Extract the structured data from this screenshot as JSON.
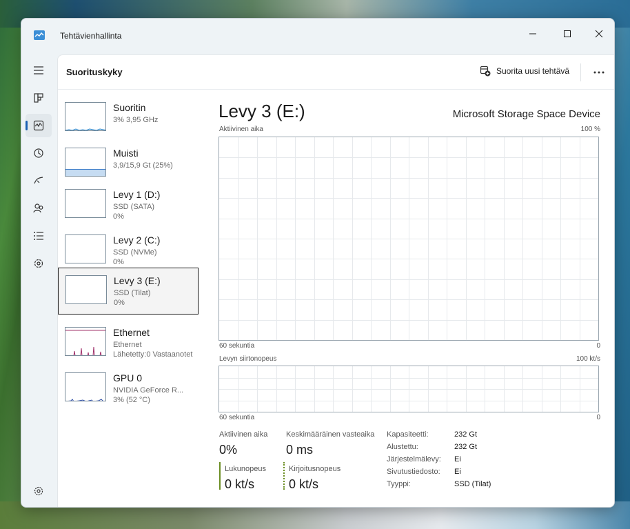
{
  "window": {
    "title": "Tehtävienhallinta"
  },
  "header": {
    "page_title": "Suorituskyky",
    "run_task_label": "Suorita uusi tehtävä"
  },
  "devices": [
    {
      "name": "Suoritin",
      "sub1": "3% 3,95 GHz",
      "sub2": ""
    },
    {
      "name": "Muisti",
      "sub1": "3,9/15,9 Gt (25%)",
      "sub2": ""
    },
    {
      "name": "Levy 1 (D:)",
      "sub1": "SSD (SATA)",
      "sub2": "0%"
    },
    {
      "name": "Levy 2 (C:)",
      "sub1": "SSD (NVMe)",
      "sub2": "0%"
    },
    {
      "name": "Levy 3 (E:)",
      "sub1": "SSD (Tilat)",
      "sub2": "0%"
    },
    {
      "name": "Ethernet",
      "sub1": "Ethernet",
      "sub2": "Lähetetty:0 Vastaanotet"
    },
    {
      "name": "GPU 0",
      "sub1": "NVIDIA GeForce R...",
      "sub2": "3% (52 °C)"
    }
  ],
  "main": {
    "title": "Levy 3 (E:)",
    "model": "Microsoft Storage Space Device",
    "graph1": {
      "label": "Aktiivinen aika",
      "max": "100 %",
      "time": "60 sekuntia",
      "min": "0"
    },
    "graph2": {
      "label": "Levyn siirtonopeus",
      "max": "100 kt/s",
      "time": "60 sekuntia",
      "min": "0"
    },
    "stats": {
      "active_label": "Aktiivinen aika",
      "active_value": "0%",
      "response_label": "Keskimääräinen vasteaika",
      "response_value": "0 ms",
      "read_label": "Lukunopeus",
      "read_value": "0 kt/s",
      "write_label": "Kirjoitusnopeus",
      "write_value": "0 kt/s"
    },
    "properties": [
      {
        "label": "Kapasiteetti:",
        "value": "232 Gt"
      },
      {
        "label": "Alustettu:",
        "value": "232 Gt"
      },
      {
        "label": "Järjestelmälevy:",
        "value": "Ei"
      },
      {
        "label": "Sivutustiedosto:",
        "value": "Ei"
      },
      {
        "label": "Tyyppi:",
        "value": "SSD (Tilat)"
      }
    ]
  },
  "colors": {
    "accent": "#1a5fb4",
    "cpu": "#1e7fc8",
    "memory": "#8ab4de",
    "ethernet": "#a0306a",
    "gpu": "#3050a8",
    "disk": "#6b8e23"
  },
  "icons": {
    "nav": [
      "hamburger-icon",
      "processes-icon",
      "performance-icon",
      "app-history-icon",
      "startup-icon",
      "users-icon",
      "details-icon",
      "services-icon",
      "settings-icon"
    ]
  }
}
